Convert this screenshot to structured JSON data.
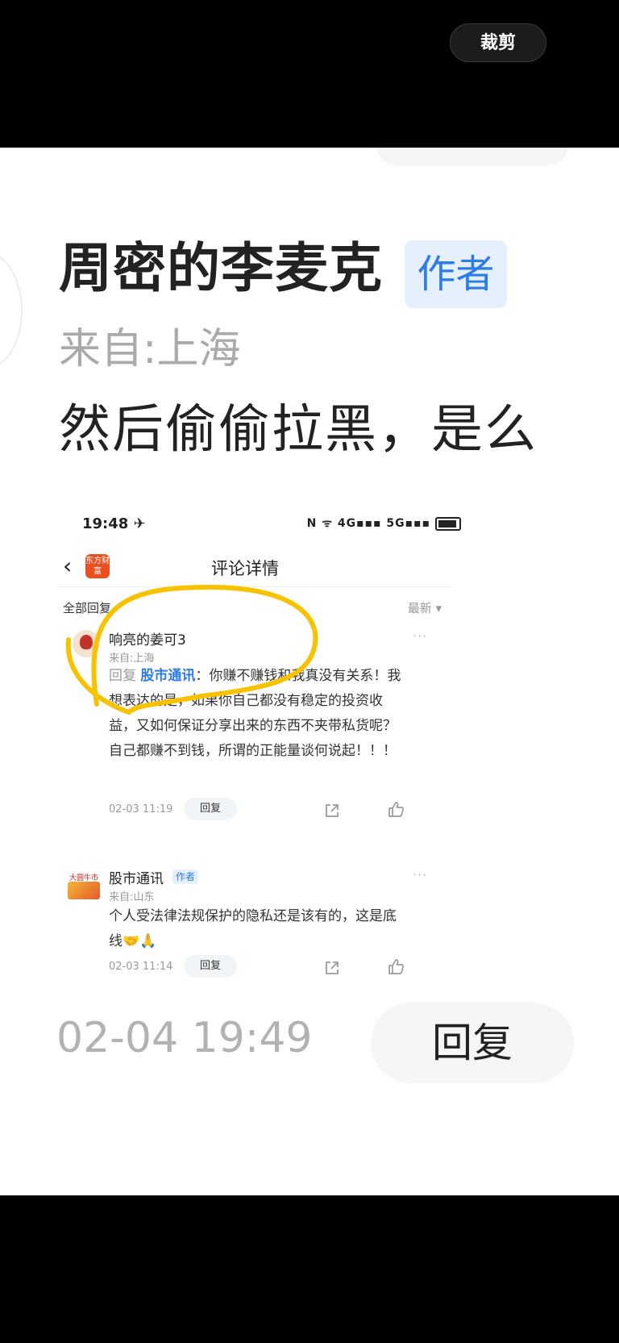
{
  "topbar": {
    "crop_label": "裁剪"
  },
  "header": {
    "author_name": "周密的李麦克",
    "author_badge": "作者",
    "origin": "来自:上海",
    "comment": "然后偷偷拉黑，是么"
  },
  "screenshot": {
    "status": {
      "time": "19:48 ✈",
      "icons": "N ᯤ 4G▪▪▪ 5G▪▪▪"
    },
    "title": "评论详情",
    "app_logo": "东方财富",
    "all_replies": "全部回复",
    "sort": "最新 ▾",
    "comments": [
      {
        "name": "响亮的姜可3",
        "location": "来自:上海",
        "reply_prefix": "回复 ",
        "mention": "股市通讯",
        "text": "：你赚不赚钱和我真没有关系！我想表达的是，如果你自己都没有稳定的投资收益，又如何保证分享出来的东西不夹带私货呢？自己都赚不到钱，所谓的正能量谈何说起！！！",
        "time": "02-03 11:19",
        "reply_label": "回复"
      },
      {
        "name": "股市通讯",
        "badge": "作者",
        "avatar_text": "大圆牛市",
        "location": "来自:山东",
        "text": "个人受法律法规保护的隐私还是该有的，这是底线🤝🙏",
        "time": "02-03 11:14",
        "reply_label": "回复"
      }
    ],
    "more": "···"
  },
  "footer": {
    "timestamp": "02-04 19:49",
    "reply_label": "回复"
  },
  "colors": {
    "accent_blue": "#2d7be5",
    "annotation_yellow": "#f7c300",
    "badge_bg": "#e6f0fc"
  }
}
